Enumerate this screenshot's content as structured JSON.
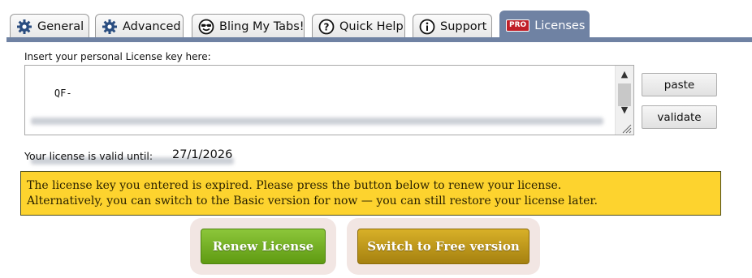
{
  "tabs": [
    {
      "label": "General",
      "icon": "gear-icon"
    },
    {
      "label": "Advanced",
      "icon": "gear-icon"
    },
    {
      "label": "Bling My Tabs!",
      "icon": "smiley-sunglasses-icon"
    },
    {
      "label": "Quick Help",
      "icon": "question-icon"
    },
    {
      "label": "Support",
      "icon": "info-icon"
    },
    {
      "label": "Licenses",
      "icon": "pro-badge",
      "badge": "PRO",
      "active": true
    }
  ],
  "license": {
    "field_label": "Insert your personal License key here:",
    "key_prefix": "QF-",
    "paste_label": "paste",
    "validate_label": "validate",
    "valid_until_label": "Your license is valid until:",
    "valid_until_date": "27/1/2026"
  },
  "warning": {
    "line1": "The license key you entered is expired. Please press the button below to renew your license.",
    "line2": "Alternatively, you can switch to the Basic version for now — you can still restore your license later."
  },
  "actions": {
    "renew_label": "Renew License",
    "free_label": "Switch to Free version"
  },
  "colors": {
    "tab_active": "#6f82a3",
    "warning_bg": "#fdd32e",
    "renew_green": "#6fae1f",
    "free_gold": "#c09a1c",
    "pro_red": "#c01f28"
  }
}
